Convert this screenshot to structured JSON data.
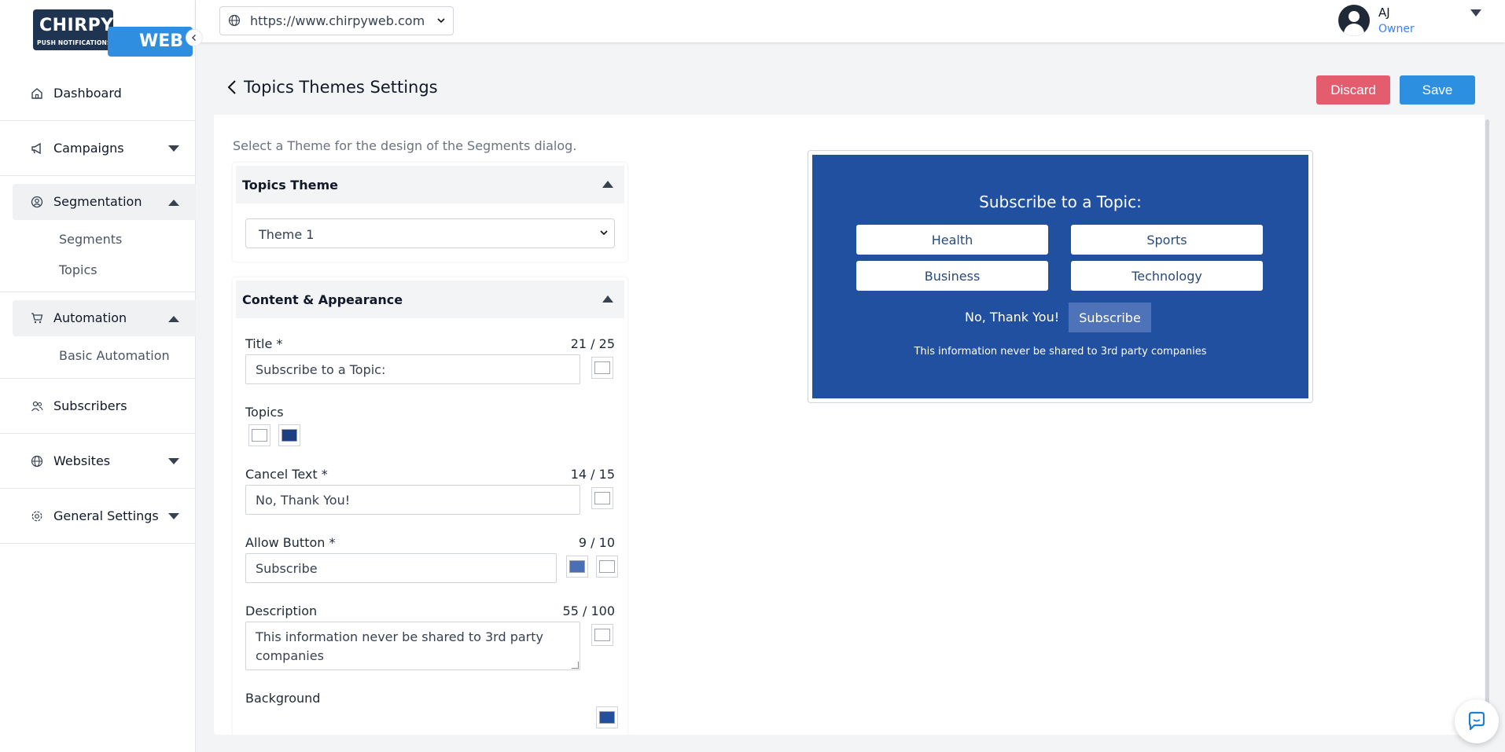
{
  "app": {
    "logo_top": "CHIRPY",
    "logo_tag": "PUSH NOTIFICATIONS",
    "logo_bottom": "WEB"
  },
  "sidebar": {
    "items": [
      {
        "label": "Dashboard",
        "icon": "home-icon"
      },
      {
        "label": "Campaigns",
        "icon": "megaphone-icon"
      },
      {
        "label": "Segmentation",
        "icon": "user-circle-icon",
        "subitems": [
          "Segments",
          "Topics"
        ]
      },
      {
        "label": "Automation",
        "icon": "cart-icon",
        "subitems": [
          "Basic Automation"
        ]
      },
      {
        "label": "Subscribers",
        "icon": "users-icon"
      },
      {
        "label": "Websites",
        "icon": "globe-icon"
      },
      {
        "label": "General Settings",
        "icon": "gear-icon"
      }
    ]
  },
  "topbar": {
    "website_url": "https://www.chirpyweb.com",
    "user_name": "AJ",
    "user_role": "Owner"
  },
  "page": {
    "title": "Topics Themes Settings",
    "discard_label": "Discard",
    "save_label": "Save",
    "intro": "Select a Theme for the design of the Segments dialog."
  },
  "theme_panel": {
    "title": "Topics Theme",
    "selected_theme": "Theme 1"
  },
  "content_panel": {
    "title": "Content & Appearance",
    "title_label": "Title *",
    "title_count": "21 / 25",
    "title_value": "Subscribe to a Topic:",
    "topics_label": "Topics",
    "cancel_label": "Cancel Text *",
    "cancel_count": "14 / 15",
    "cancel_value": "No, Thank You!",
    "allow_label": "Allow Button *",
    "allow_count": "9 / 10",
    "allow_value": "Subscribe",
    "description_label": "Description",
    "description_count": "55 / 100",
    "description_value": "This information never be shared to 3rd party companies",
    "background_label": "Background"
  },
  "colors": {
    "preview_background": "#2150a0",
    "topic_text": "#2a4a7a",
    "allow_button_bg": "#4f73b8",
    "topics_swatch_dark": "#1c3f82",
    "allow_swatch": "#4a6fb5",
    "background_swatch": "#22509e"
  },
  "preview": {
    "title": "Subscribe to a Topic:",
    "topics": [
      "Health",
      "Sports",
      "Business",
      "Technology"
    ],
    "cancel_text": "No, Thank You!",
    "allow_text": "Subscribe",
    "description": "This information never be shared to 3rd party companies"
  }
}
